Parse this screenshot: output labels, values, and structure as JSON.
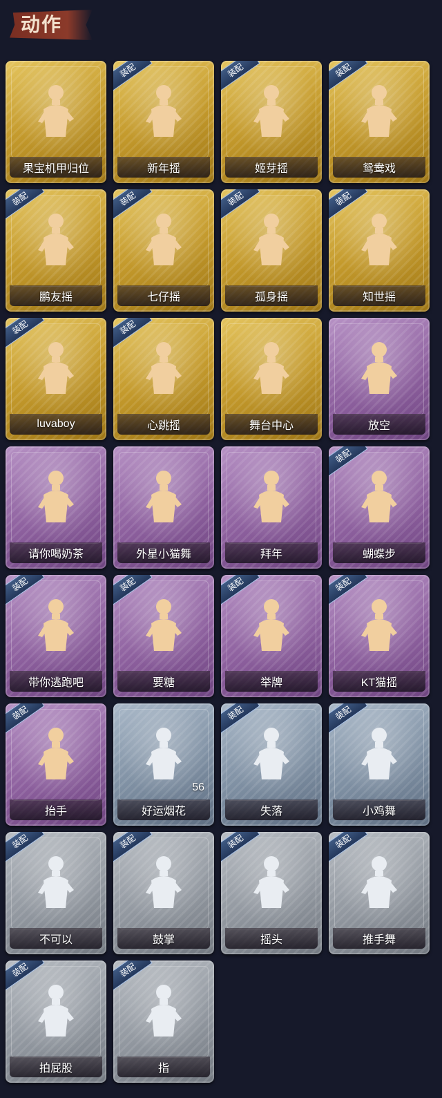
{
  "page": {
    "title": "动作",
    "equip_badge": "装配"
  },
  "colors": {
    "gold": "#c49a2c",
    "purple": "#8e619f",
    "blue": "#7f90a3",
    "gray": "#9298a0",
    "badge": "#2f4670",
    "background": "#16192a"
  },
  "items": [
    {
      "label": "果宝机甲归位",
      "rarity": "gold",
      "equipped": false
    },
    {
      "label": "新年摇",
      "rarity": "gold",
      "equipped": true
    },
    {
      "label": "姬芽摇",
      "rarity": "gold",
      "equipped": true
    },
    {
      "label": "鸳鸯戏",
      "rarity": "gold",
      "equipped": true
    },
    {
      "label": "鹏友摇",
      "rarity": "gold",
      "equipped": true
    },
    {
      "label": "七仔摇",
      "rarity": "gold",
      "equipped": true
    },
    {
      "label": "孤身摇",
      "rarity": "gold",
      "equipped": true
    },
    {
      "label": "知世摇",
      "rarity": "gold",
      "equipped": true
    },
    {
      "label": "luvaboy",
      "rarity": "gold",
      "equipped": true
    },
    {
      "label": "心跳摇",
      "rarity": "gold",
      "equipped": true
    },
    {
      "label": "舞台中心",
      "rarity": "gold",
      "equipped": false
    },
    {
      "label": "放空",
      "rarity": "purple",
      "equipped": false
    },
    {
      "label": "请你喝奶茶",
      "rarity": "purple",
      "equipped": false
    },
    {
      "label": "外星小猫舞",
      "rarity": "purple",
      "equipped": false
    },
    {
      "label": "拜年",
      "rarity": "purple",
      "equipped": false
    },
    {
      "label": "蝴蝶步",
      "rarity": "purple",
      "equipped": true
    },
    {
      "label": "带你逃跑吧",
      "rarity": "purple",
      "equipped": true
    },
    {
      "label": "要糖",
      "rarity": "purple",
      "equipped": true
    },
    {
      "label": "举牌",
      "rarity": "purple",
      "equipped": true
    },
    {
      "label": "KT猫摇",
      "rarity": "purple",
      "equipped": true
    },
    {
      "label": "抬手",
      "rarity": "purple",
      "equipped": true
    },
    {
      "label": "好运烟花",
      "rarity": "blue",
      "equipped": false,
      "count": "56"
    },
    {
      "label": "失落",
      "rarity": "blue",
      "equipped": true
    },
    {
      "label": "小鸡舞",
      "rarity": "blue",
      "equipped": true
    },
    {
      "label": "不可以",
      "rarity": "gray",
      "equipped": true
    },
    {
      "label": "鼓掌",
      "rarity": "gray",
      "equipped": true
    },
    {
      "label": "摇头",
      "rarity": "gray",
      "equipped": true
    },
    {
      "label": "推手舞",
      "rarity": "gray",
      "equipped": true
    },
    {
      "label": "拍屁股",
      "rarity": "gray",
      "equipped": true
    },
    {
      "label": "指",
      "rarity": "gray",
      "equipped": true
    }
  ]
}
